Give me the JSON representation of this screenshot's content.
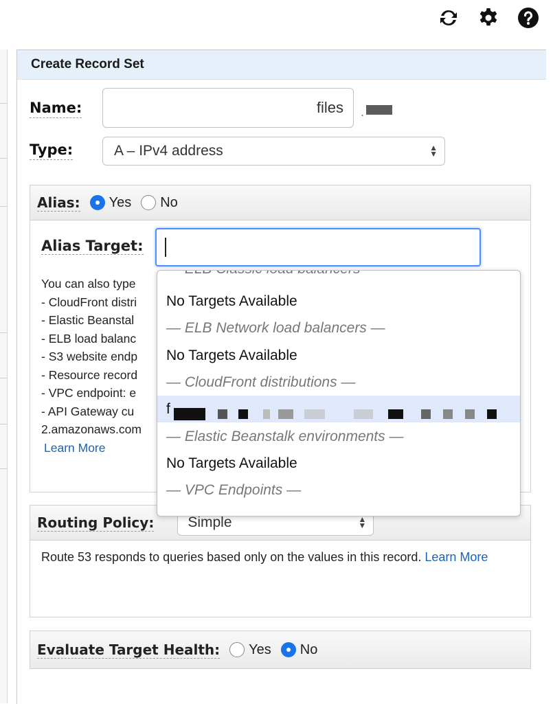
{
  "toolbar": {
    "icons": [
      "refresh-icon",
      "gear-icon",
      "help-icon"
    ]
  },
  "panel": {
    "title": "Create Record Set",
    "name": {
      "label": "Name:",
      "value": "files",
      "suffix": "."
    },
    "type": {
      "label": "Type:",
      "value": "A – IPv4 address"
    },
    "alias": {
      "label": "Alias:",
      "options": [
        "Yes",
        "No"
      ],
      "selected": "Yes",
      "target_label": "Alias Target:",
      "target_value": "",
      "help_lines": [
        "You can also type",
        "- CloudFront distri",
        "- Elastic Beanstal",
        "- ELB load balanc",
        "- S3 website endp",
        "- Resource record",
        "- VPC endpoint: e",
        "- API Gateway cu",
        "2.amazonaws.com"
      ],
      "learn_more": "Learn More"
    },
    "dropdown": {
      "rows": [
        {
          "kind": "group",
          "text": "— ELB Classic load balancers —"
        },
        {
          "kind": "item",
          "text": "No Targets Available"
        },
        {
          "kind": "group",
          "text": "— ELB Network load balancers —"
        },
        {
          "kind": "item",
          "text": "No Targets Available"
        },
        {
          "kind": "group",
          "text": "— CloudFront distributions —"
        },
        {
          "kind": "item",
          "text": "f"
        },
        {
          "kind": "group",
          "text": "— Elastic Beanstalk environments —"
        },
        {
          "kind": "item",
          "text": "No Targets Available"
        },
        {
          "kind": "group",
          "text": "— VPC Endpoints —"
        }
      ]
    },
    "routing": {
      "label": "Routing Policy:",
      "value": "Simple",
      "description": "Route 53 responds to queries based only on the values in this record.",
      "learn_more": "Learn More"
    },
    "health": {
      "label": "Evaluate Target Health:",
      "options": [
        "Yes",
        "No"
      ],
      "selected": "No"
    }
  },
  "colors": {
    "accent": "#1a73e8",
    "header_bg": "#e6f0fb",
    "link": "#1a64b3"
  }
}
